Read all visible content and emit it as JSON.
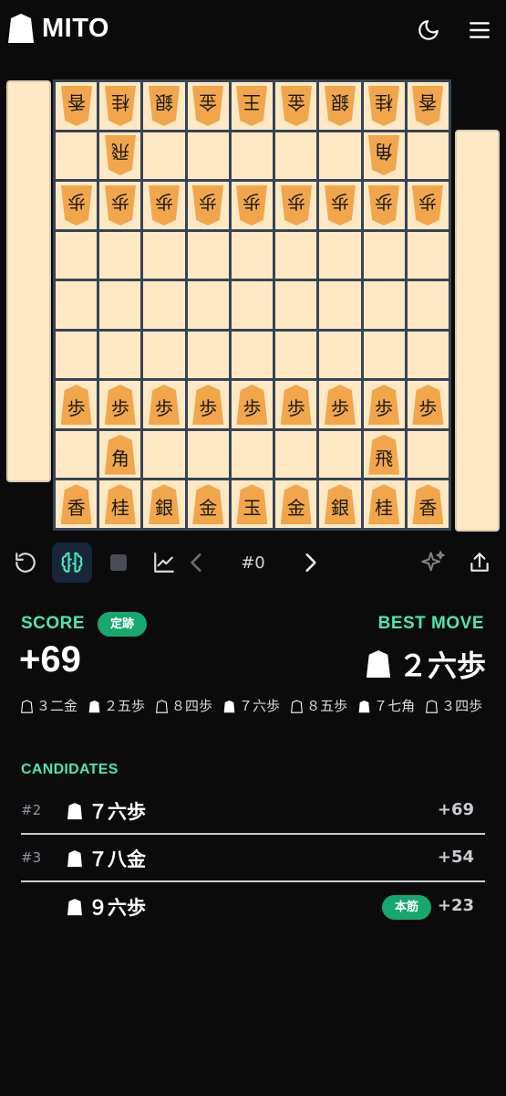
{
  "app": {
    "title": "MITO"
  },
  "header": {
    "theme_icon": "moon-icon",
    "menu_icon": "hamburger-menu-icon"
  },
  "board": {
    "rows": [
      [
        {
          "p": "香",
          "s": "g"
        },
        {
          "p": "桂",
          "s": "g"
        },
        {
          "p": "銀",
          "s": "g"
        },
        {
          "p": "金",
          "s": "g"
        },
        {
          "p": "王",
          "s": "g"
        },
        {
          "p": "金",
          "s": "g"
        },
        {
          "p": "銀",
          "s": "g"
        },
        {
          "p": "桂",
          "s": "g"
        },
        {
          "p": "香",
          "s": "g"
        }
      ],
      [
        null,
        {
          "p": "飛",
          "s": "g"
        },
        null,
        null,
        null,
        null,
        null,
        {
          "p": "角",
          "s": "g"
        },
        null
      ],
      [
        {
          "p": "歩",
          "s": "g"
        },
        {
          "p": "歩",
          "s": "g"
        },
        {
          "p": "歩",
          "s": "g"
        },
        {
          "p": "歩",
          "s": "g"
        },
        {
          "p": "歩",
          "s": "g"
        },
        {
          "p": "歩",
          "s": "g"
        },
        {
          "p": "歩",
          "s": "g"
        },
        {
          "p": "歩",
          "s": "g"
        },
        {
          "p": "歩",
          "s": "g"
        }
      ],
      [
        null,
        null,
        null,
        null,
        null,
        null,
        null,
        null,
        null
      ],
      [
        null,
        null,
        null,
        null,
        null,
        null,
        null,
        null,
        null
      ],
      [
        null,
        null,
        null,
        null,
        null,
        null,
        null,
        null,
        null
      ],
      [
        {
          "p": "歩",
          "s": "s"
        },
        {
          "p": "歩",
          "s": "s"
        },
        {
          "p": "歩",
          "s": "s"
        },
        {
          "p": "歩",
          "s": "s"
        },
        {
          "p": "歩",
          "s": "s"
        },
        {
          "p": "歩",
          "s": "s"
        },
        {
          "p": "歩",
          "s": "s"
        },
        {
          "p": "歩",
          "s": "s"
        },
        {
          "p": "歩",
          "s": "s"
        }
      ],
      [
        null,
        {
          "p": "角",
          "s": "s"
        },
        null,
        null,
        null,
        null,
        null,
        {
          "p": "飛",
          "s": "s"
        },
        null
      ],
      [
        {
          "p": "香",
          "s": "s"
        },
        {
          "p": "桂",
          "s": "s"
        },
        {
          "p": "銀",
          "s": "s"
        },
        {
          "p": "金",
          "s": "s"
        },
        {
          "p": "玉",
          "s": "s"
        },
        {
          "p": "金",
          "s": "s"
        },
        {
          "p": "銀",
          "s": "s"
        },
        {
          "p": "桂",
          "s": "s"
        },
        {
          "p": "香",
          "s": "s"
        }
      ]
    ]
  },
  "toolbar": {
    "move_number": "#0",
    "icons": [
      "undo-icon",
      "brain-icon",
      "stop-icon",
      "chart-icon",
      "prev-arrow-icon",
      "next-arrow-icon",
      "sparkle-icon",
      "share-icon"
    ]
  },
  "analysis": {
    "score_label": "SCORE",
    "score_badge": "定跡",
    "score_value": "+69",
    "best_move_label": "BEST MOVE",
    "best_move": "２六歩",
    "pv": [
      {
        "side": "gote",
        "move": "３二金"
      },
      {
        "side": "sente",
        "move": "２五歩"
      },
      {
        "side": "gote",
        "move": "８四歩"
      },
      {
        "side": "sente",
        "move": "７六歩"
      },
      {
        "side": "gote",
        "move": "８五歩"
      },
      {
        "side": "sente",
        "move": "７七角"
      },
      {
        "side": "gote",
        "move": "３四歩"
      }
    ]
  },
  "candidates": {
    "label": "CANDIDATES",
    "items": [
      {
        "rank": "#2",
        "move": "７六歩",
        "score": "+69",
        "badge": ""
      },
      {
        "rank": "#3",
        "move": "７八金",
        "score": "+54",
        "badge": ""
      },
      {
        "rank": "",
        "move": "９六歩",
        "score": "+23",
        "badge": "本筋"
      }
    ]
  },
  "colors": {
    "accent": "#4ee6b4",
    "badge": "#16a86d",
    "board_bg": "#ffe9c4",
    "piece": "#f2a64c",
    "grid": "#364456"
  }
}
